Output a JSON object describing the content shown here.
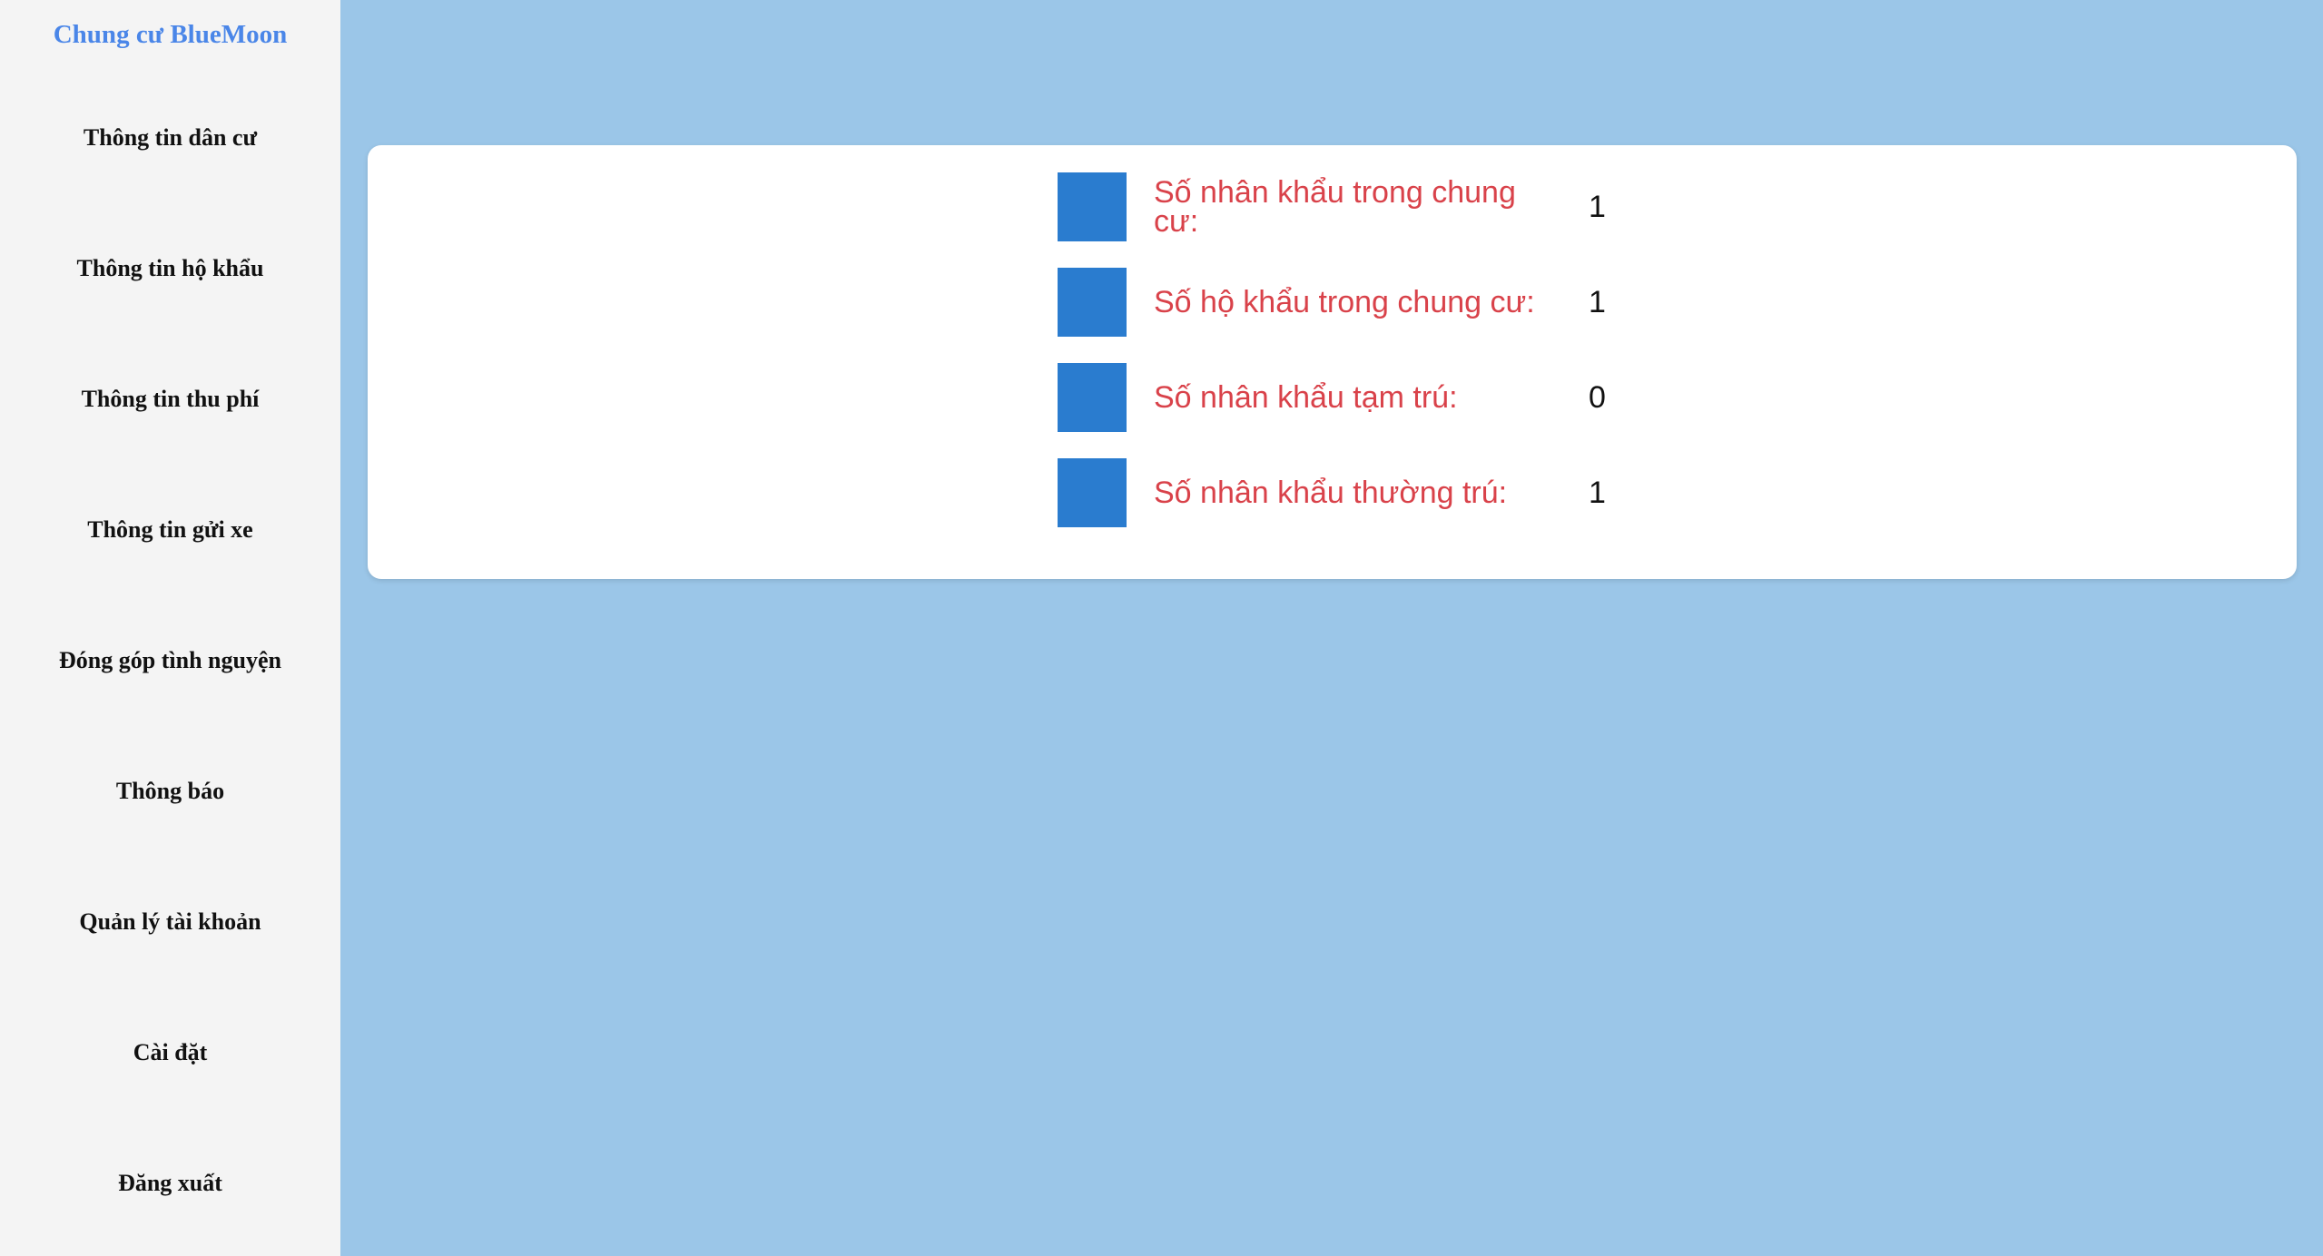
{
  "app": {
    "brand": "Chung cư BlueMoon"
  },
  "sidebar": {
    "items": [
      {
        "label": "Thông tin dân cư"
      },
      {
        "label": "Thông tin hộ khẩu"
      },
      {
        "label": "Thông tin thu phí"
      },
      {
        "label": "Thông tin gửi xe"
      },
      {
        "label": "Đóng góp tình nguyện"
      },
      {
        "label": "Thông báo"
      },
      {
        "label": "Quản lý tài khoản"
      },
      {
        "label": "Cài đặt"
      },
      {
        "label": "Đăng xuất"
      }
    ]
  },
  "stats": [
    {
      "label": "Số nhân khẩu trong chung cư:",
      "value": "1"
    },
    {
      "label": "Số hộ khẩu trong chung cư:",
      "value": "1"
    },
    {
      "label": "Số nhân khẩu tạm trú:",
      "value": "0"
    },
    {
      "label": "Số nhân khẩu thường trú:",
      "value": "1"
    }
  ],
  "colors": {
    "background": "#9bc6e8",
    "sidebar": "#f4f4f4",
    "brand": "#4a86e8",
    "stat_label": "#d9424a",
    "stat_square": "#2a7ccf"
  }
}
